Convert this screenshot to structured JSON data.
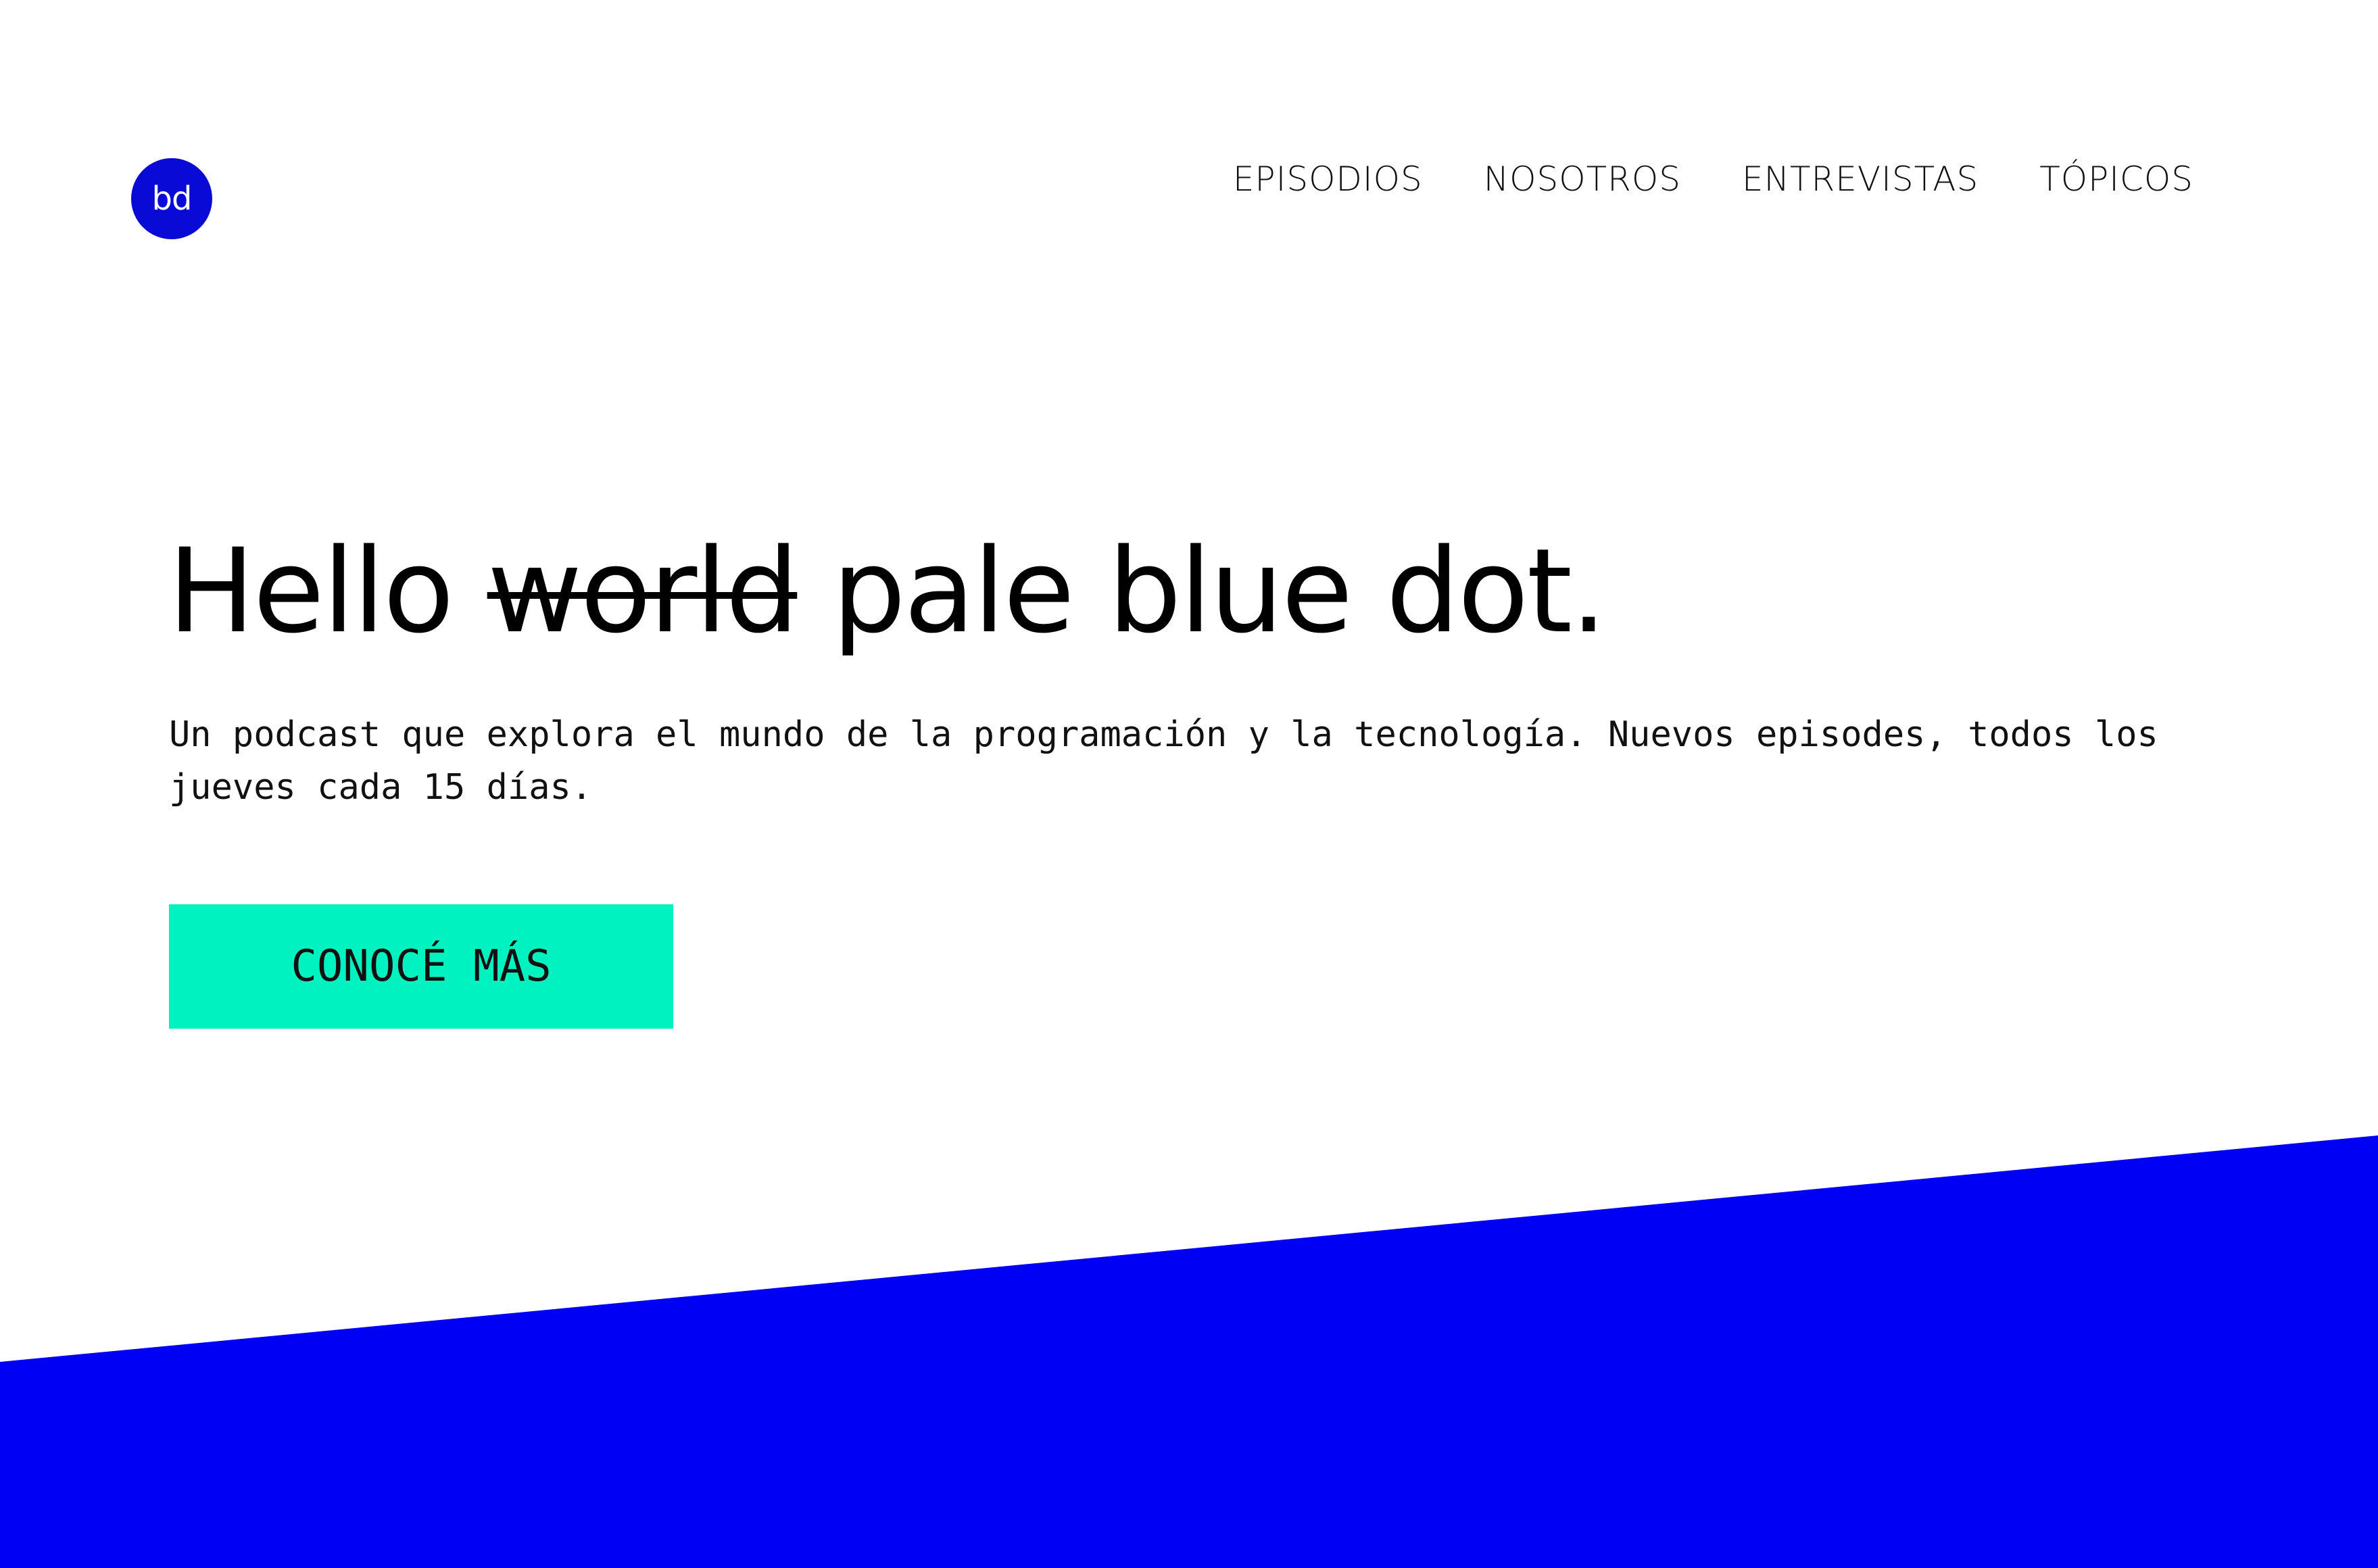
{
  "brand": {
    "logo_text": "bd",
    "logo_color": "#0a0ad6"
  },
  "nav": {
    "items": [
      "EPISODIOS",
      "NOSOTROS",
      "ENTREVISTAS",
      "TÓPICOS"
    ]
  },
  "hero": {
    "title_lead": "Hello",
    "title_struck": "world",
    "title_rest": "pale blue dot.",
    "subtitle": "Un podcast que explora el mundo de la programación y la tecnología. Nuevos episodes, todos los jueves cada 15 días.",
    "cta_label": "CONOCÉ MÁS",
    "cta_color": "#00f2c0"
  },
  "decor": {
    "band_color": "#0000f5"
  }
}
